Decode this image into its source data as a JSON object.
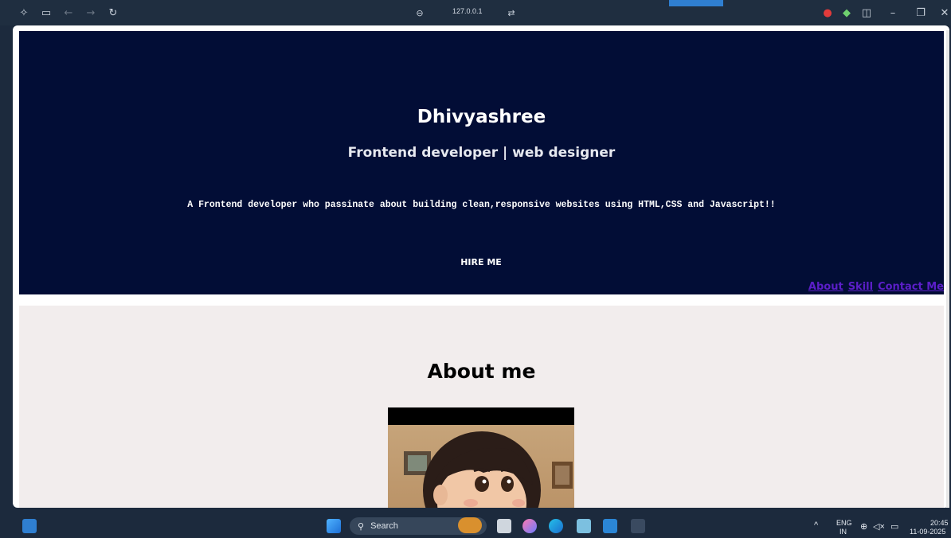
{
  "browser": {
    "url": "127.0.0.1",
    "icons": [
      "copilot-icon",
      "sidebar-icon",
      "back-icon",
      "forward-icon",
      "refresh-icon",
      "link-icon",
      "reader-icon",
      "extension-red-icon",
      "extension-green-icon",
      "split-icon",
      "minimize-icon",
      "restore-icon",
      "close-icon"
    ]
  },
  "hero": {
    "name": "Dhivyashree",
    "subtitle": "Frontend developer | web designer",
    "description": "A Frontend developer who passinate about building clean,responsive websites using HTML,CSS and Javascript!!",
    "hire_label": "HIRE ME",
    "nav": [
      {
        "label": "About"
      },
      {
        "label": "Skill"
      },
      {
        "label": "Contact Me"
      }
    ],
    "colors": {
      "background": "#020d36",
      "link": "#5b1ec8"
    }
  },
  "about": {
    "title": "About me",
    "background": "#f2eded"
  },
  "taskbar": {
    "search_label": "Search",
    "language_top": "ENG",
    "language_bottom": "IN",
    "time": "20:45",
    "date": "11-09-2025"
  }
}
